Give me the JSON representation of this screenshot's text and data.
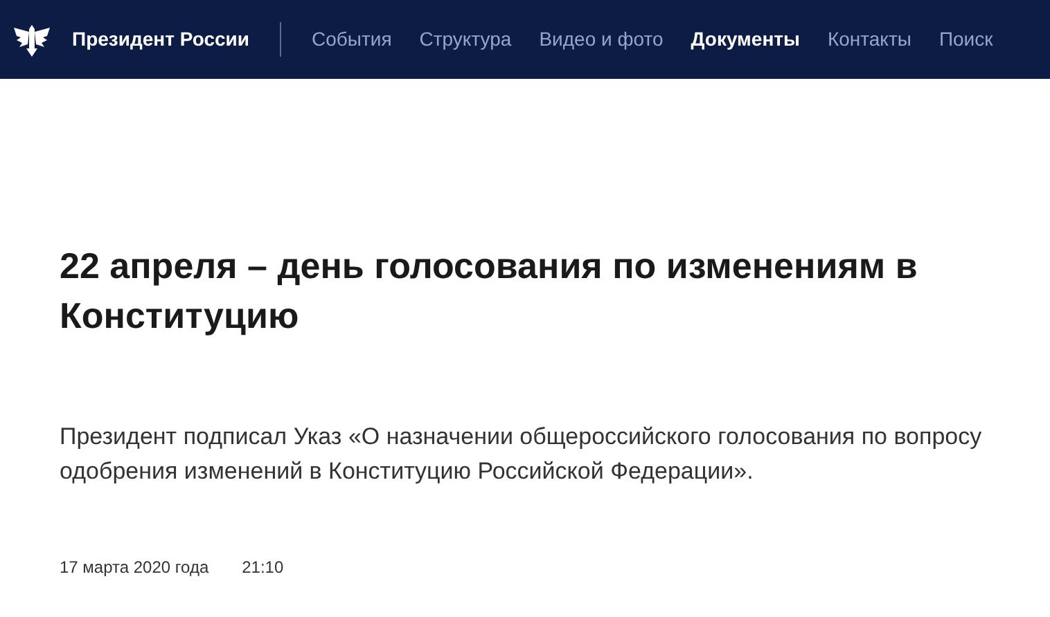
{
  "header": {
    "site_title": "Президент России",
    "nav": [
      {
        "label": "События",
        "selected": false
      },
      {
        "label": "Структура",
        "selected": false
      },
      {
        "label": "Видео и фото",
        "selected": false
      },
      {
        "label": "Документы",
        "selected": true
      },
      {
        "label": "Контакты",
        "selected": false
      },
      {
        "label": "Поиск",
        "selected": false
      }
    ]
  },
  "article": {
    "title": "22 апреля – день голосования по изменениям в Конституцию",
    "lead": "Президент подписал Указ «О назначении общероссийского голосования по вопросу одобрения изменений в Конституцию Российской Федерации».",
    "date": "17 марта 2020 года",
    "time": "21:10"
  }
}
